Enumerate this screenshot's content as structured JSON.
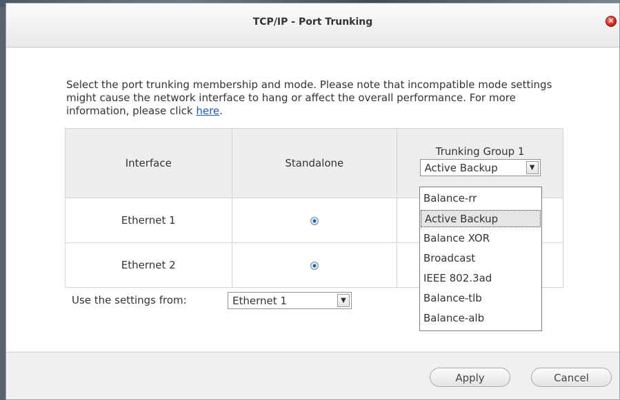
{
  "window": {
    "title": "TCP/IP - Port Trunking"
  },
  "description": {
    "text": "Select the port trunking membership and mode. Please note that incompatible mode settings might cause the network interface to hang or affect the overall performance. For more information, please click ",
    "link": "here",
    "suffix": "."
  },
  "table": {
    "headers": {
      "interface": "Interface",
      "standalone": "Standalone",
      "group": "Trunking Group 1"
    },
    "group_mode": "Active Backup",
    "rows": [
      {
        "interface": "Ethernet 1",
        "standalone": true
      },
      {
        "interface": "Ethernet 2",
        "standalone": true
      }
    ]
  },
  "mode_options": [
    "Balance-rr",
    "Active Backup",
    "Balance XOR",
    "Broadcast",
    "IEEE 802.3ad",
    "Balance-tlb",
    "Balance-alb"
  ],
  "mode_selected": "Active Backup",
  "use_settings": {
    "label": "Use the settings from:",
    "value": "Ethernet 1"
  },
  "buttons": {
    "apply": "Apply",
    "cancel": "Cancel"
  },
  "icons": {
    "close": "close-icon",
    "dropdown": "chevron-down-icon",
    "radio": "radio-selected-icon"
  }
}
